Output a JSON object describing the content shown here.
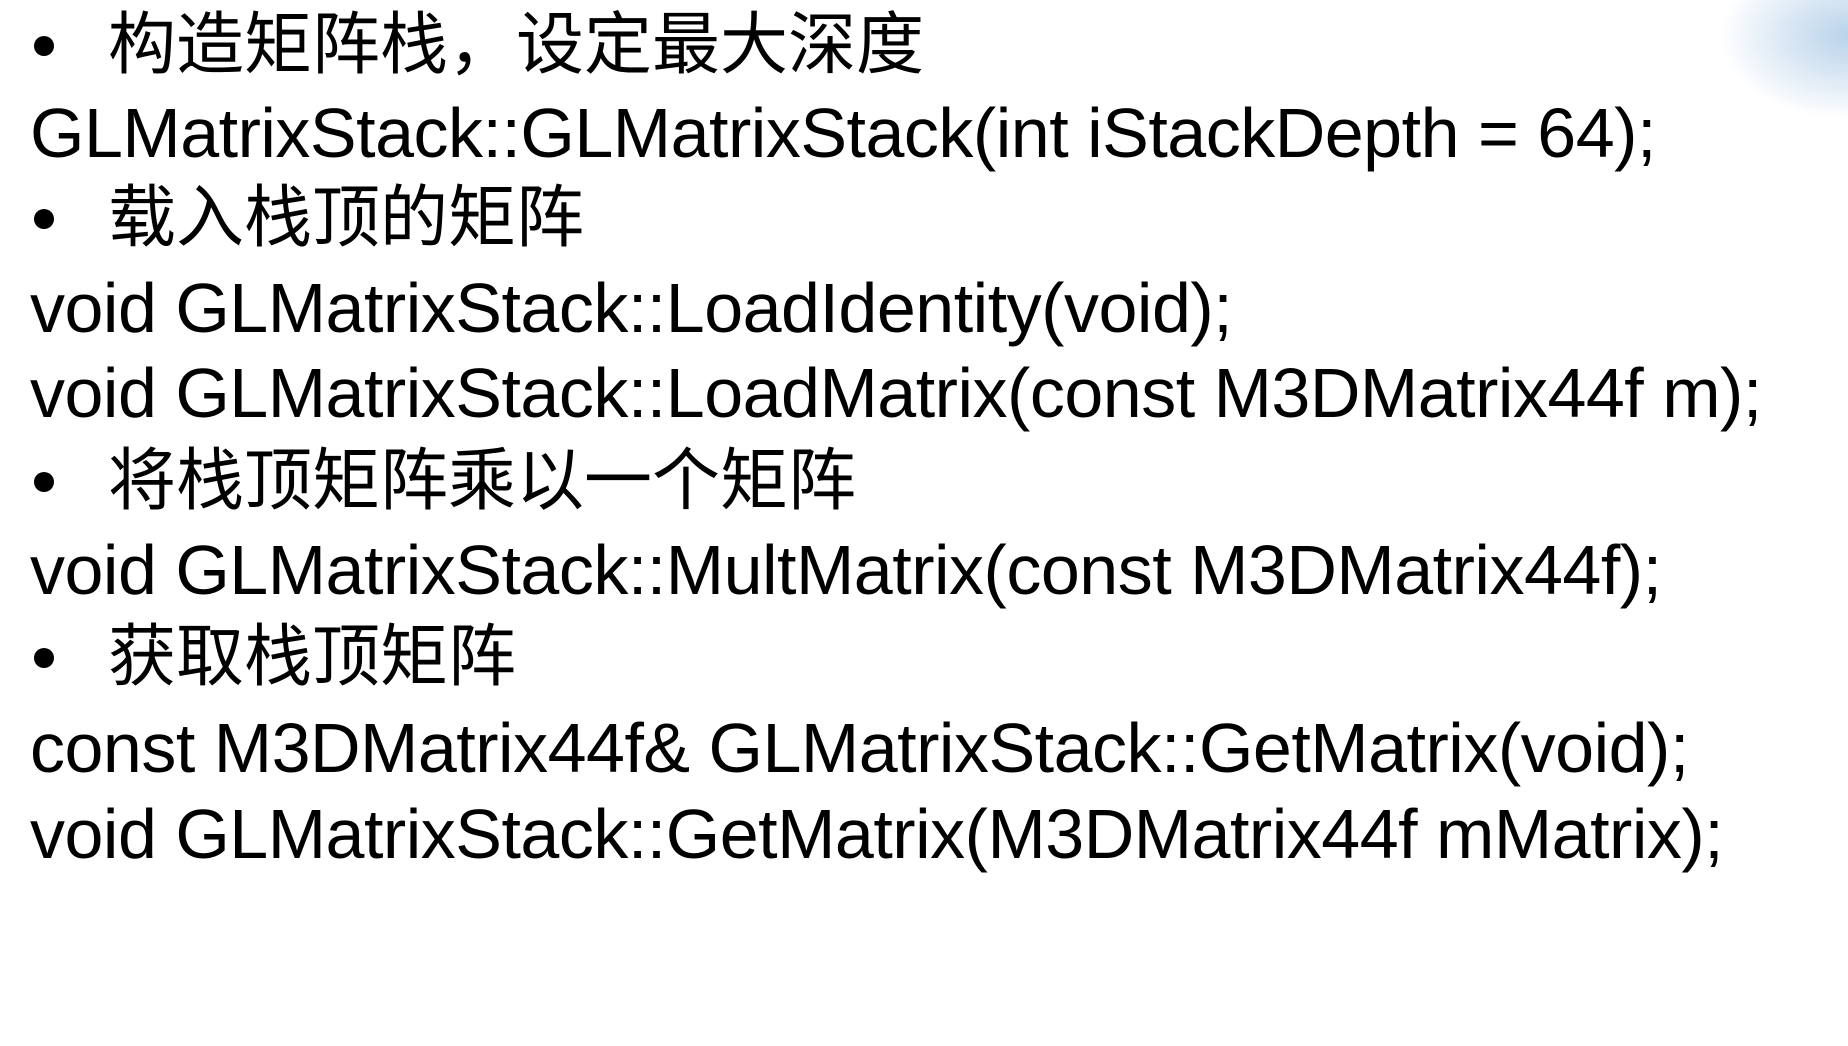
{
  "slide": {
    "items": [
      {
        "kind": "bullet",
        "text": "构造矩阵栈，设定最大深度"
      },
      {
        "kind": "code",
        "text": "GLMatrixStack::GLMatrixStack(int iStackDepth = 64);"
      },
      {
        "kind": "bullet",
        "text": "载入栈顶的矩阵"
      },
      {
        "kind": "code",
        "text": "void GLMatrixStack::LoadIdentity(void);"
      },
      {
        "kind": "code",
        "text": "void GLMatrixStack::LoadMatrix(const M3DMatrix44f m);"
      },
      {
        "kind": "bullet",
        "text": "将栈顶矩阵乘以一个矩阵"
      },
      {
        "kind": "code",
        "text": "void GLMatrixStack::MultMatrix(const M3DMatrix44f);"
      },
      {
        "kind": "bullet",
        "text": "获取栈顶矩阵"
      },
      {
        "kind": "code",
        "text": "const M3DMatrix44f& GLMatrixStack::GetMatrix(void);"
      },
      {
        "kind": "code",
        "text": "void GLMatrixStack::GetMatrix(M3DMatrix44f mMatrix);"
      }
    ]
  }
}
